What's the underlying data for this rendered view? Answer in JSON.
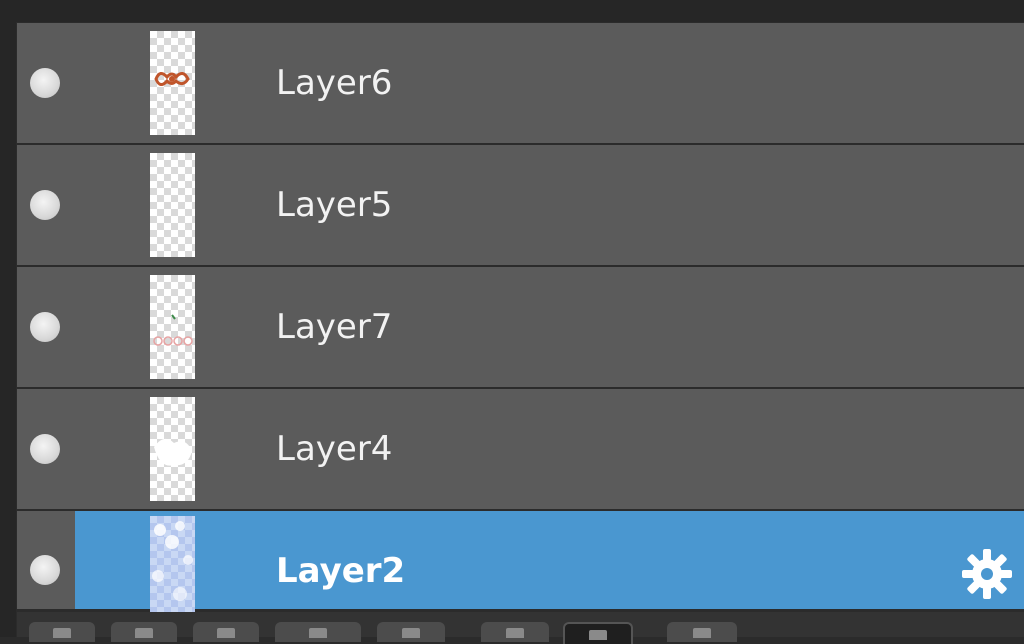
{
  "layers_panel": {
    "layers": [
      {
        "name": "Layer6",
        "selected": false,
        "thumb_icon": "orange-bow-thumbnail"
      },
      {
        "name": "Layer5",
        "selected": false,
        "thumb_icon": "transparent-thumbnail"
      },
      {
        "name": "Layer7",
        "selected": false,
        "thumb_icon": "pink-sketch-thumbnail"
      },
      {
        "name": "Layer4",
        "selected": false,
        "thumb_icon": "white-shape-thumbnail"
      },
      {
        "name": "Layer2",
        "selected": true,
        "thumb_icon": "blue-cloud-thumbnail"
      }
    ],
    "selected_settings_icon": "gear-icon",
    "visibility_icon": "visibility-dot-icon"
  },
  "colors": {
    "row_background": "#5b5b5b",
    "selected_background": "#4a97d0",
    "panel_background": "#2b2b2b",
    "text": "#f2f2f2"
  },
  "toolbar": {
    "buttons": [
      "new-layer-icon",
      "duplicate-layer-icon",
      "merge-layer-icon",
      "layer-group-icon",
      "mask-icon",
      "layer-style-icon",
      "delete-layer-icon",
      "settings-icon"
    ]
  }
}
